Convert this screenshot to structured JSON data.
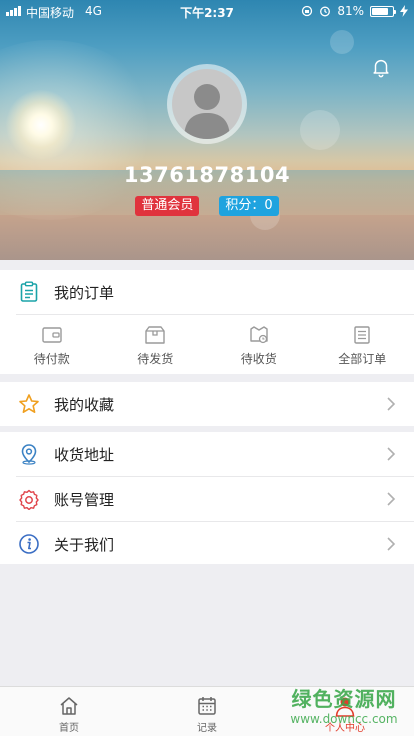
{
  "status_bar": {
    "carrier": "中国移动",
    "network": "4G",
    "time": "下午2:37",
    "battery": "81%",
    "battery_level": 0.81
  },
  "profile": {
    "phone": "13761878104",
    "member_level": "普通会员",
    "points": "积分：0"
  },
  "orders": {
    "title": "我的订单",
    "items": [
      {
        "label": "待付款",
        "icon": "wallet-icon"
      },
      {
        "label": "待发货",
        "icon": "box-icon"
      },
      {
        "label": "待收货",
        "icon": "truck-icon"
      },
      {
        "label": "全部订单",
        "icon": "list-icon"
      }
    ]
  },
  "favorites": {
    "label": "我的收藏",
    "icon": "star-icon"
  },
  "menu": [
    {
      "label": "收货地址",
      "icon": "location-icon"
    },
    {
      "label": "账号管理",
      "icon": "gear-icon"
    },
    {
      "label": "关于我们",
      "icon": "info-icon"
    }
  ],
  "tabbar": {
    "items": [
      {
        "label": "首页",
        "icon": "home-icon"
      },
      {
        "label": "记录",
        "icon": "calendar-icon"
      },
      {
        "label": "个人中心",
        "icon": "person-icon",
        "active": true
      }
    ]
  },
  "watermark": {
    "title": "绿色资源网",
    "url": "www.downcc.com"
  },
  "colors": {
    "accent": "#e23b2a",
    "member_badge": "#e0333d",
    "points_badge": "#1fa3df",
    "order_icon": "#1aa3a8"
  }
}
